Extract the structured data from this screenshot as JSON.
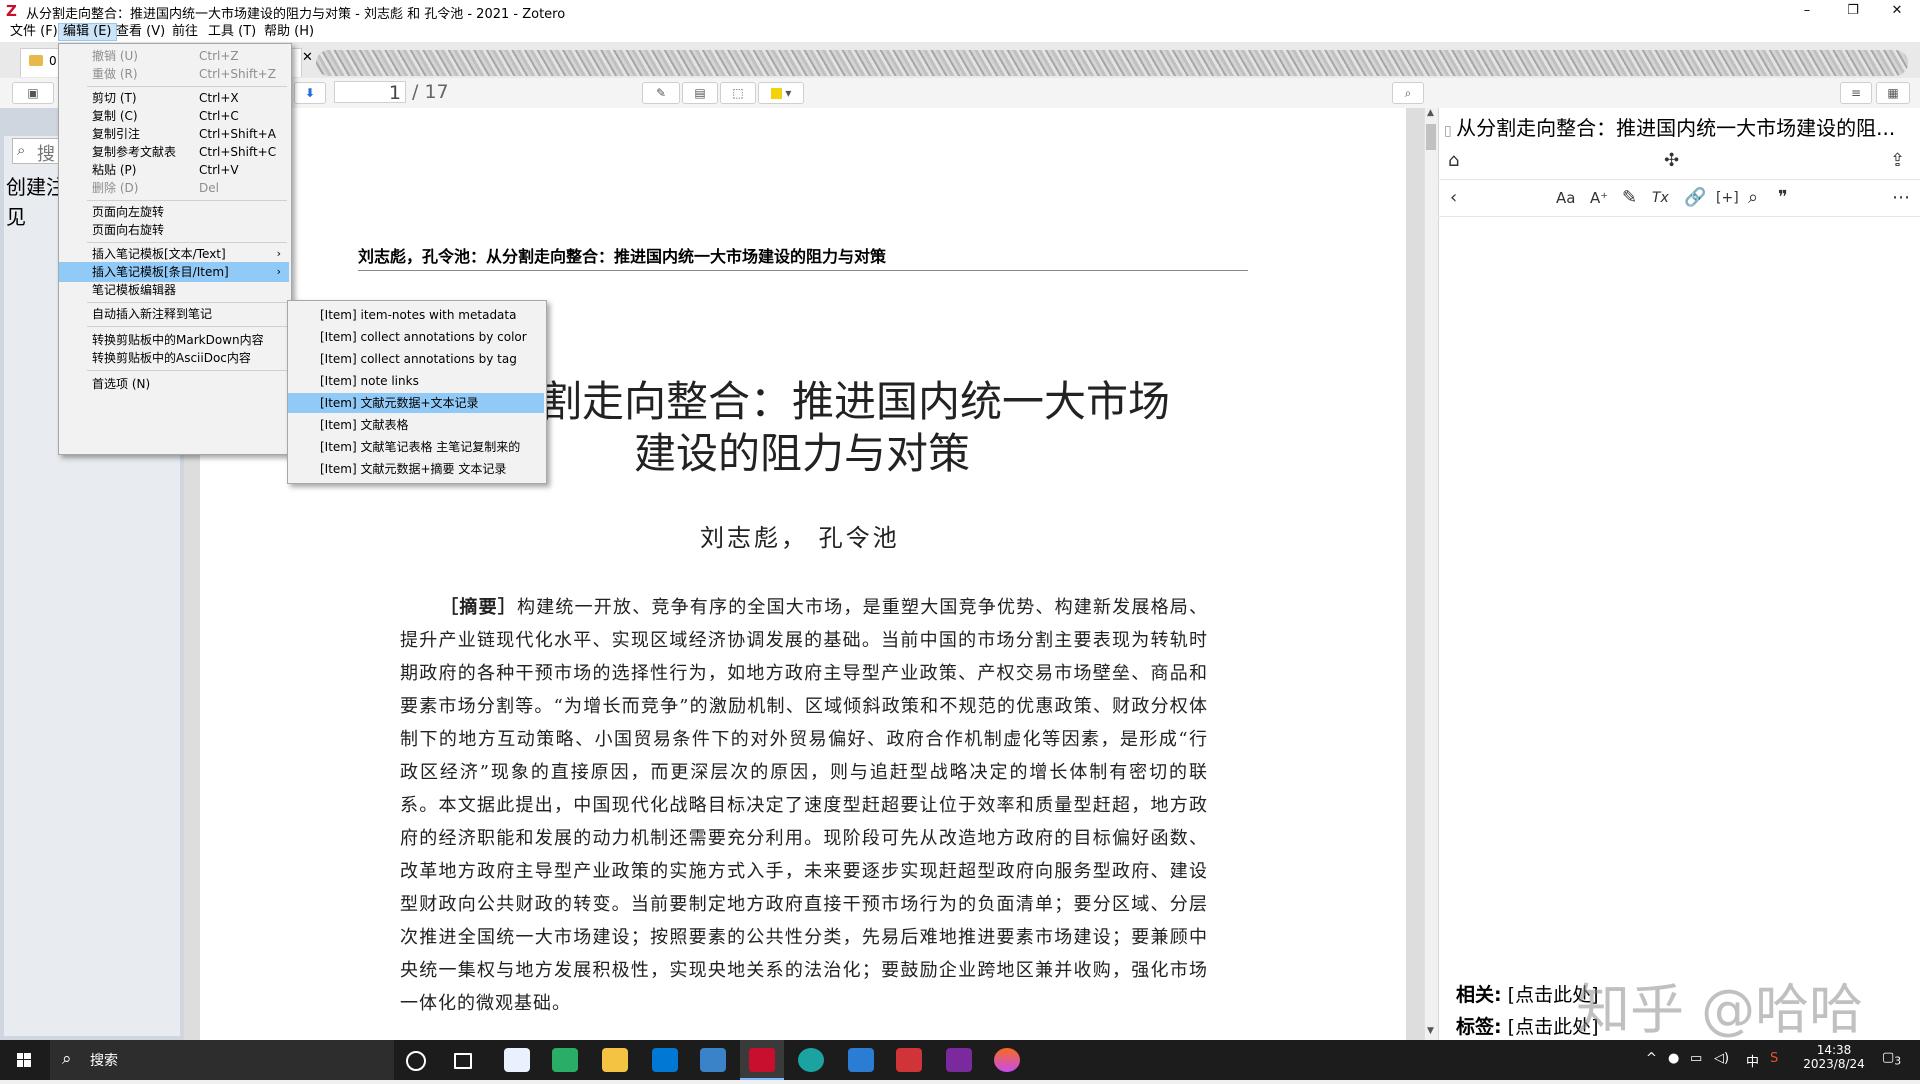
{
  "window": {
    "title": "从分割走向整合：推进国内统一大市场建设的阻力与对策 - 刘志彪 和 孔令池 - 2021 - Zotero",
    "icon_letter": "Z",
    "controls": [
      "–",
      "❐",
      "✕"
    ]
  },
  "menubar": [
    "文件 (F)",
    "编辑 (E)",
    "查看 (V)",
    "前往",
    "工具 (T)",
    "帮助 (H)"
  ],
  "tabs": {
    "library_label": "0",
    "close": "✕"
  },
  "toolbar": {
    "page_current": "1",
    "page_total": "/ 17"
  },
  "left_pane": {
    "search_placeholder": "搜",
    "create_text_line1": "创建注",
    "create_text_line2": "见"
  },
  "edit_menu": [
    {
      "label": "撤销 (U)",
      "shortcut": "Ctrl+Z",
      "disabled": true
    },
    {
      "label": "重做 (R)",
      "shortcut": "Ctrl+Shift+Z",
      "disabled": true
    },
    {
      "label": "剪切 (T)",
      "shortcut": "Ctrl+X"
    },
    {
      "label": "复制 (C)",
      "shortcut": "Ctrl+C"
    },
    {
      "label": "复制引注",
      "shortcut": "Ctrl+Shift+A"
    },
    {
      "label": "复制参考文献表",
      "shortcut": "Ctrl+Shift+C"
    },
    {
      "label": "粘贴 (P)",
      "shortcut": "Ctrl+V"
    },
    {
      "label": "删除 (D)",
      "shortcut": "Del",
      "disabled": true
    },
    {
      "label": "页面向左旋转"
    },
    {
      "label": "页面向右旋转"
    },
    {
      "label": "插入笔记模板[文本/Text]",
      "submenu": true
    },
    {
      "label": "插入笔记模板[条目/Item]",
      "submenu": true,
      "highlighted": true
    },
    {
      "label": "笔记模板编辑器"
    },
    {
      "label": "自动插入新注释到笔记"
    },
    {
      "label": "转换剪贴板中的MarkDown内容"
    },
    {
      "label": "转换剪贴板中的AsciiDoc内容"
    },
    {
      "label": "首选项 (N)"
    }
  ],
  "item_submenu": [
    "[Item] item-notes with metadata",
    "[Item] collect annotations by color",
    "[Item] collect annotations by tag",
    "[Item] note links",
    "[Item] 文献元数据+文本记录",
    "[Item] 文献表格",
    "[Item] 文献笔记表格 主笔记复制来的",
    "[Item] 文献元数据+摘要 文本记录"
  ],
  "pdf": {
    "running_head": "刘志彪，孔令池：从分割走向整合：推进国内统一大市场建设的阻力与对策",
    "title_line1": "割走向整合：推进国内统一大市场",
    "title_line2": "建设的阻力与对策",
    "authors": "刘志彪，  孔令池",
    "abstract_label": "［摘要］",
    "abstract_text": "构建统一开放、竞争有序的全国大市场，是重塑大国竞争优势、构建新发展格局、提升产业链现代化水平、实现区域经济协调发展的基础。当前中国的市场分割主要表现为转轨时期政府的各种干预市场的选择性行为，如地方政府主导型产业政策、产权交易市场壁垒、商品和要素市场分割等。“为增长而竞争”的激励机制、区域倾斜政策和不规范的优惠政策、财政分权体制下的地方互动策略、小国贸易条件下的对外贸易偏好、政府合作机制虚化等因素，是形成“行政区经济”现象的直接原因，而更深层次的原因，则与追赶型战略决定的增长体制有密切的联系。本文据此提出，中国现代化战略目标决定了速度型赶超要让位于效率和质量型赶超，地方政府的经济职能和发展的动力机制还需要充分利用。现阶段可先从改造地方政府的目标偏好函数、改革地方政府主导型产业政策的实施方式入手，未来要逐步实现赶超型政府向服务型政府、建设型财政向公共财政的转变。当前要制定地方政府直接干预市场行为的负面清单；要分区域、分层次推进全国统一大市场建设；按照要素的公共性分类，先易后难地推进要素市场建设；要兼顾中央统一集权与地方发展积极性，实现央地关系的法治化；要鼓励企业跨地区兼并收购，强化市场一体化的微观基础。"
  },
  "note": {
    "title": "从分割走向整合：推进国内统一大市场建设的阻...",
    "related_label": "相关:",
    "related_value": "[点击此处]",
    "tags_label": "标签:",
    "tags_value": "[点击此处]",
    "watermark": "知乎 @哈哈"
  },
  "taskbar": {
    "search": "搜索",
    "time": "14:38",
    "date": "2023/8/24",
    "ime": "中",
    "notifications": "3"
  }
}
